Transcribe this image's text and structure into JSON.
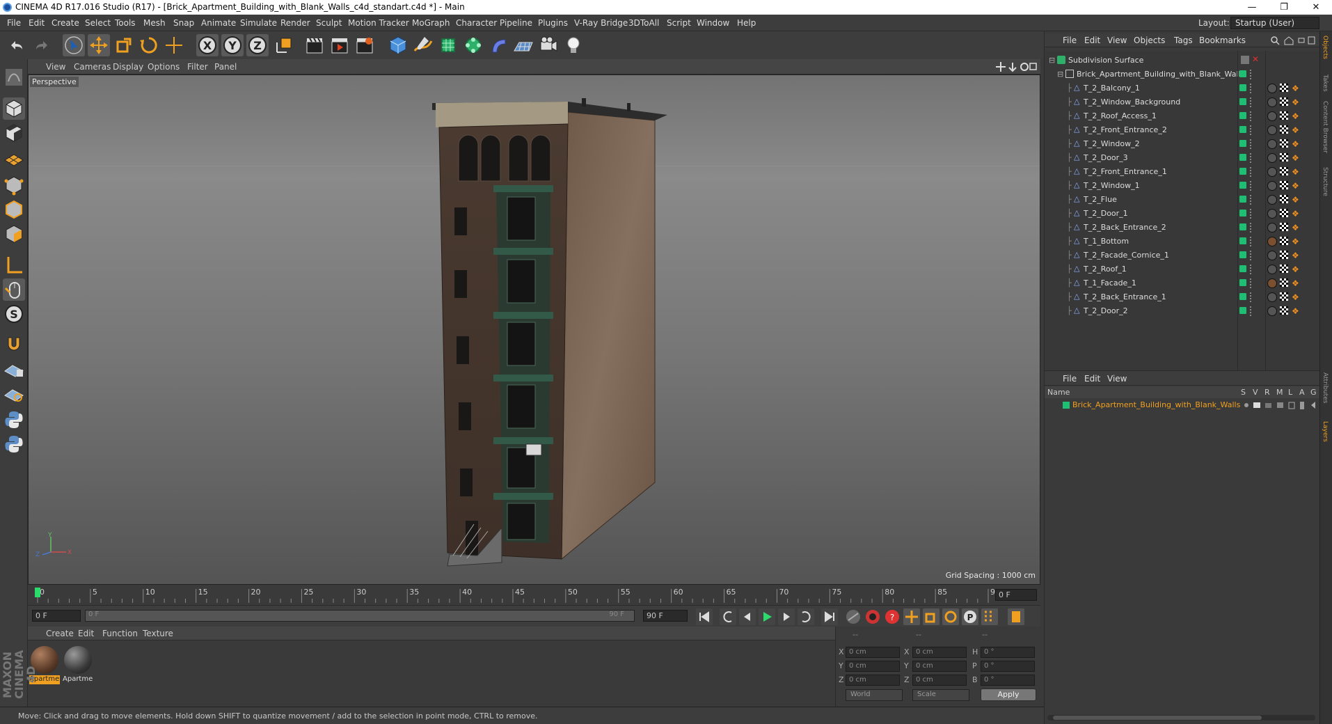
{
  "window": {
    "title": "CINEMA 4D R17.016 Studio (R17) - [Brick_Apartment_Building_with_Blank_Walls_c4d_standart.c4d *] - Main"
  },
  "menubar": {
    "items": [
      "File",
      "Edit",
      "Create",
      "Select",
      "Tools",
      "Mesh",
      "Snap",
      "Animate",
      "Simulate",
      "Render",
      "Sculpt",
      "Motion Tracker",
      "MoGraph",
      "Character",
      "Pipeline",
      "Plugins",
      "V-Ray Bridge",
      "3DToAll",
      "Script",
      "Window",
      "Help"
    ],
    "layout_label": "Layout:",
    "layout_value": "Startup (User)"
  },
  "maintool": {
    "axis_x": "X",
    "axis_y": "Y",
    "axis_z": "Z"
  },
  "viewport": {
    "menu": [
      "View",
      "Cameras",
      "Display",
      "Options",
      "Filter",
      "Panel"
    ],
    "label": "Perspective",
    "grid_spacing": "Grid Spacing : 1000 cm",
    "axis_y": "Y",
    "axis_z": "Z",
    "axis_x": "X"
  },
  "timeline": {
    "ticks": [
      "0",
      "5",
      "10",
      "15",
      "20",
      "25",
      "30",
      "35",
      "40",
      "45",
      "50",
      "55",
      "60",
      "65",
      "70",
      "75",
      "80",
      "85",
      "90"
    ],
    "current_frame": "0 F"
  },
  "playback": {
    "start": "0 F",
    "range_start": "0 F",
    "range_end": "90 F",
    "end": "90 F"
  },
  "material_manager": {
    "menu": [
      "Create",
      "Edit",
      "Function",
      "Texture"
    ],
    "materials": [
      {
        "label": "Apartme"
      },
      {
        "label": "Apartme"
      }
    ]
  },
  "coordinates": {
    "header": [
      "--",
      "--",
      "--"
    ],
    "rows": [
      {
        "l1": "X",
        "v1": "0 cm",
        "l2": "X",
        "v2": "0 cm",
        "l3": "H",
        "v3": "0 °"
      },
      {
        "l1": "Y",
        "v1": "0 cm",
        "l2": "Y",
        "v2": "0 cm",
        "l3": "P",
        "v3": "0 °"
      },
      {
        "l1": "Z",
        "v1": "0 cm",
        "l2": "Z",
        "v2": "0 cm",
        "l3": "B",
        "v3": "0 °"
      }
    ],
    "world": "World",
    "scale": "Scale",
    "apply": "Apply"
  },
  "status": "Move: Click and drag to move elements. Hold down SHIFT to quantize movement / add to the selection in point mode, CTRL to remove.",
  "logo": "MAXON CINEMA 4D",
  "object_manager": {
    "menu": [
      "File",
      "Edit",
      "View",
      "Objects",
      "Tags",
      "Bookmarks"
    ],
    "root": "Subdivision Surface",
    "group": "Brick_Apartment_Building_with_Blank_Walls",
    "objects": [
      "T_2_Balcony_1",
      "T_2_Window_Background",
      "T_2_Roof_Access_1",
      "T_2_Front_Entrance_2",
      "T_2_Window_2",
      "T_2_Door_3",
      "T_2_Front_Entrance_1",
      "T_2_Window_1",
      "T_2_Flue",
      "T_2_Door_1",
      "T_2_Back_Entrance_2",
      "T_1_Bottom",
      "T_2_Facade_Cornice_1",
      "T_2_Roof_1",
      "T_1_Facade_1",
      "T_2_Back_Entrance_1",
      "T_2_Door_2"
    ]
  },
  "layer_manager": {
    "menu": [
      "File",
      "Edit",
      "View"
    ],
    "columns": [
      "Name",
      "S",
      "V",
      "R",
      "M",
      "L",
      "A",
      "G"
    ],
    "layer_name": "Brick_Apartment_Building_with_Blank_Walls"
  },
  "right_tabs": [
    "Objects",
    "Takes",
    "Content Browser",
    "Structure",
    "Attributes",
    "Layers"
  ],
  "colors": {
    "accent_green": "#1fbf73",
    "accent_orange": "#f0a020",
    "bg_panel": "#3a3a3a"
  }
}
